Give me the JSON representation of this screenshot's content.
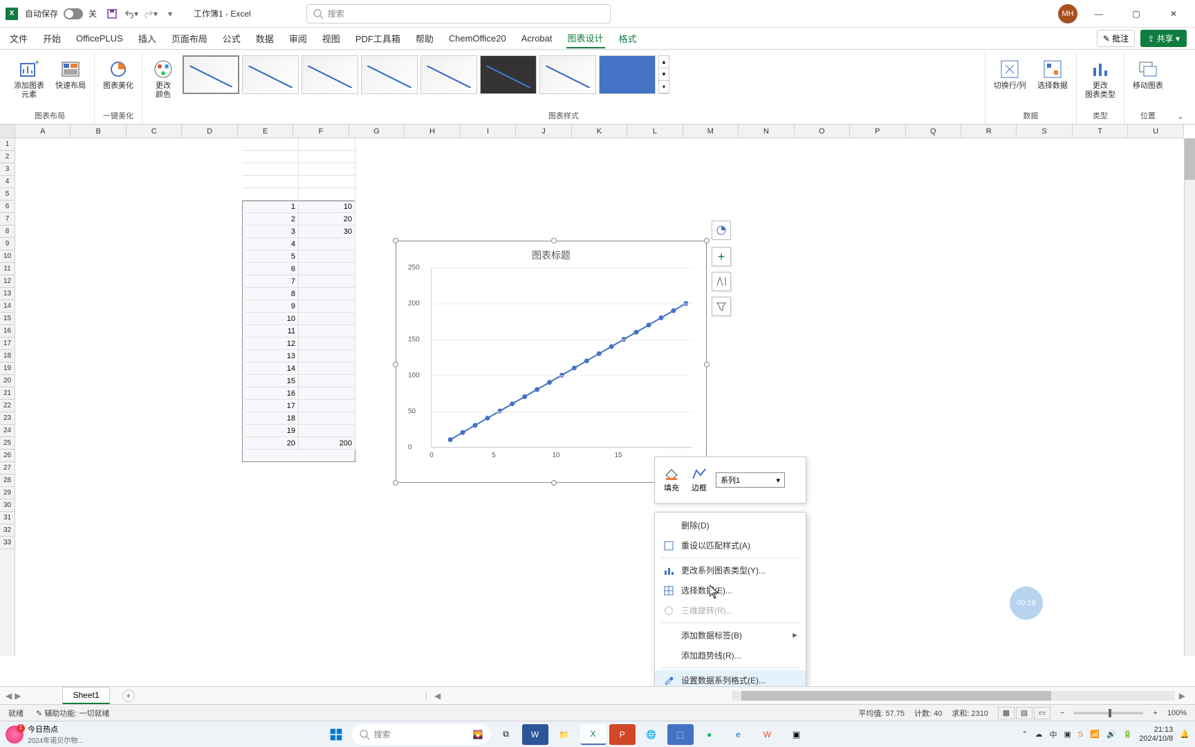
{
  "titlebar": {
    "app_icon_text": "X",
    "autosave_label": "自动保存",
    "autosave_off": "关",
    "doc_name": "工作簿1 - Excel",
    "search_placeholder": "搜索",
    "user_initials": "MH"
  },
  "tabs": {
    "file": "文件",
    "home": "开始",
    "officeplus": "OfficePLUS",
    "insert": "插入",
    "pagelayout": "页面布局",
    "formulas": "公式",
    "data": "数据",
    "review": "审阅",
    "view": "视图",
    "pdf": "PDF工具箱",
    "help": "帮助",
    "chem": "ChemOffice20",
    "acrobat": "Acrobat",
    "chartdesign": "图表设计",
    "format": "格式",
    "comment": "批注",
    "share": "共享"
  },
  "ribbon": {
    "layout_group": "图表布局",
    "add_element": "添加图表\n元素",
    "quick_layout": "快速布局",
    "beautify_group": "一键美化",
    "beautify": "图表美化",
    "change_colors": "更改\n颜色",
    "styles_group": "图表样式",
    "data_group": "数据",
    "switch_rc": "切换行/列",
    "select_data": "选择数据",
    "type_group": "类型",
    "change_type": "更改\n图表类型",
    "location_group": "位置",
    "move_chart": "移动图表"
  },
  "columns": [
    "A",
    "B",
    "C",
    "D",
    "E",
    "F",
    "G",
    "H",
    "I",
    "J",
    "K",
    "L",
    "M",
    "N",
    "O",
    "P",
    "Q",
    "R",
    "S",
    "T",
    "U"
  ],
  "chart": {
    "title": "图表标题"
  },
  "chart_data": {
    "type": "scatter",
    "title": "图表标题",
    "x": [
      1,
      2,
      3,
      4,
      5,
      6,
      7,
      8,
      9,
      10,
      11,
      12,
      13,
      14,
      15,
      16,
      17,
      18,
      19,
      20
    ],
    "series": [
      {
        "name": "系列1",
        "values": [
          10,
          20,
          30,
          40,
          50,
          60,
          70,
          80,
          90,
          100,
          110,
          120,
          130,
          140,
          150,
          160,
          170,
          180,
          190,
          200
        ]
      }
    ],
    "xlabel": "",
    "ylabel": "",
    "xlim": [
      0,
      20
    ],
    "ylim": [
      0,
      250
    ],
    "xticks": [
      0,
      5,
      10,
      15
    ],
    "yticks": [
      0,
      50,
      100,
      150,
      200,
      250
    ]
  },
  "sheet_data": {
    "col_e": [
      1,
      2,
      3,
      4,
      5,
      6,
      7,
      8,
      9,
      10,
      11,
      12,
      13,
      14,
      15,
      16,
      17,
      18,
      19,
      20
    ],
    "col_f": [
      10,
      20,
      30,
      "",
      "",
      "",
      "",
      "",
      "",
      "",
      "",
      "",
      "",
      "",
      "",
      "",
      "",
      "",
      "",
      "200"
    ]
  },
  "mini_toolbar": {
    "fill": "填充",
    "outline": "边框",
    "series_selected": "系列1"
  },
  "context_menu": {
    "delete": "删除(D)",
    "reset_style": "重设以匹配样式(A)",
    "change_series_type": "更改系列图表类型(Y)...",
    "select_data": "选择数据(E)...",
    "rotate_3d": "三维旋转(R)...",
    "add_data_labels": "添加数据标签(B)",
    "add_trendline": "添加趋势线(R)...",
    "format_series": "设置数据系列格式(E)..."
  },
  "timer": "00:16",
  "sheet_tab": "Sheet1",
  "statusbar": {
    "ready": "就绪",
    "accessibility": "辅助功能: 一切就绪",
    "average_label": "平均值:",
    "average_value": "57.75",
    "count_label": "计数:",
    "count_value": "40",
    "sum_label": "求和:",
    "sum_value": "2310",
    "zoom": "100%"
  },
  "taskbar": {
    "hot_title": "今日热点",
    "hot_sub": "2024年诺贝尔物...",
    "hot_badge": "1",
    "search": "搜索",
    "time": "21:13",
    "date": "2024/10/8"
  }
}
